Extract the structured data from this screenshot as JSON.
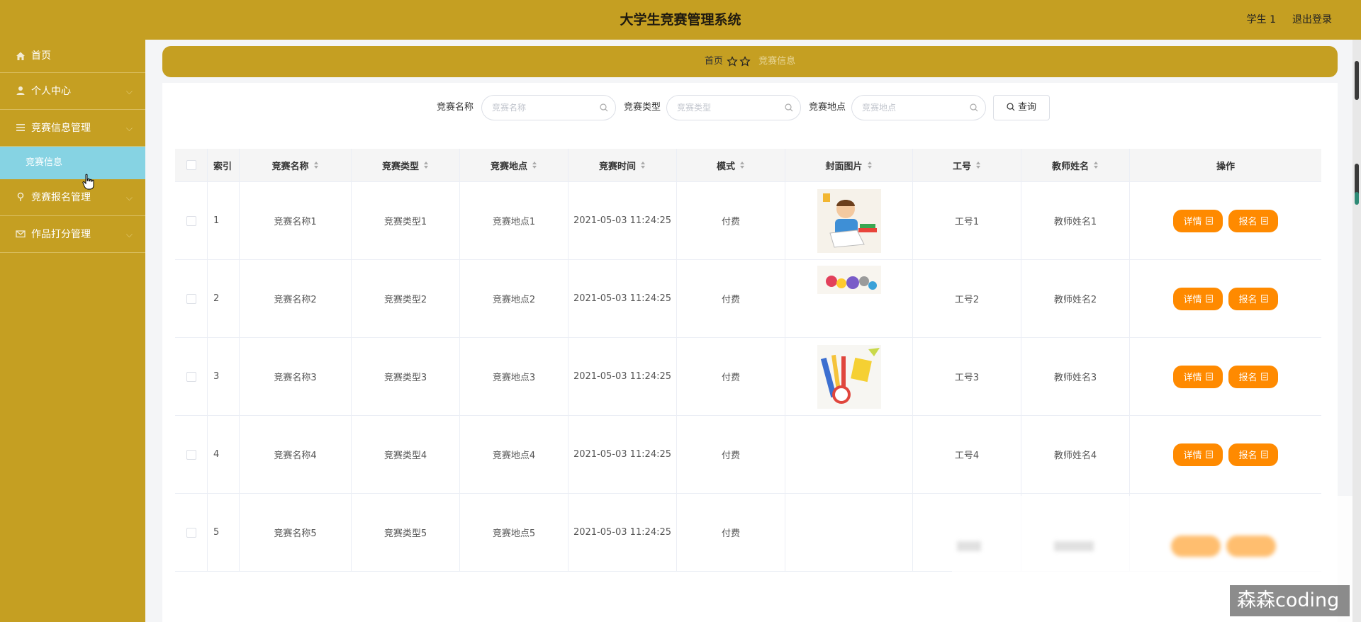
{
  "header": {
    "title": "大学生竞赛管理系统",
    "user": "学生 1",
    "logout": "退出登录"
  },
  "sidebar": {
    "items": [
      {
        "label": "首页",
        "icon": "home-icon",
        "arrow": ""
      },
      {
        "label": "个人中心",
        "icon": "user-icon",
        "arrow": "⌵"
      },
      {
        "label": "竞赛信息管理",
        "icon": "list-icon",
        "arrow": "⌵"
      },
      {
        "label": "竞赛报名管理",
        "icon": "pin-icon",
        "arrow": "⌵"
      },
      {
        "label": "作品打分管理",
        "icon": "mail-icon",
        "arrow": "⌵"
      }
    ],
    "active_sub": "竞赛信息"
  },
  "breadcrumb": {
    "home": "首页",
    "current": "竞赛信息"
  },
  "search": {
    "fields": [
      {
        "label": "竞赛名称",
        "placeholder": "竞赛名称"
      },
      {
        "label": "竞赛类型",
        "placeholder": "竞赛类型"
      },
      {
        "label": "竞赛地点",
        "placeholder": "竞赛地点"
      }
    ],
    "button": "查询"
  },
  "table": {
    "columns": [
      "索引",
      "竞赛名称",
      "竞赛类型",
      "竞赛地点",
      "竞赛时间",
      "模式",
      "封面图片",
      "工号",
      "教师姓名",
      "操作"
    ],
    "rows": [
      {
        "index": "1",
        "name": "竞赛名称1",
        "type": "竞赛类型1",
        "place": "竞赛地点1",
        "time": "2021-05-03 11:24:25",
        "mode": "付费",
        "cover": "boy-reading",
        "staff": "工号1",
        "teacher": "教师姓名1"
      },
      {
        "index": "2",
        "name": "竞赛名称2",
        "type": "竞赛类型2",
        "place": "竞赛地点2",
        "time": "2021-05-03 11:24:25",
        "mode": "付费",
        "cover": "kids-crafts",
        "staff": "工号2",
        "teacher": "教师姓名2"
      },
      {
        "index": "3",
        "name": "竞赛名称3",
        "type": "竞赛类型3",
        "place": "竞赛地点3",
        "time": "2021-05-03 11:24:25",
        "mode": "付费",
        "cover": "school-supplies",
        "staff": "工号3",
        "teacher": "教师姓名3"
      },
      {
        "index": "4",
        "name": "竞赛名称4",
        "type": "竞赛类型4",
        "place": "竞赛地点4",
        "time": "2021-05-03 11:24:25",
        "mode": "付费",
        "cover": "",
        "staff": "工号4",
        "teacher": "教师姓名4"
      },
      {
        "index": "5",
        "name": "竞赛名称5",
        "type": "竞赛类型5",
        "place": "竞赛地点5",
        "time": "2021-05-03 11:24:25",
        "mode": "付费",
        "cover": "",
        "staff": "",
        "teacher": ""
      }
    ],
    "actions": {
      "detail": "详情",
      "signup": "报名"
    }
  },
  "watermark": "森森coding",
  "colors": {
    "header": "#c59f22",
    "active_sub": "#86d3e3",
    "action_button": "#ff8a00"
  }
}
